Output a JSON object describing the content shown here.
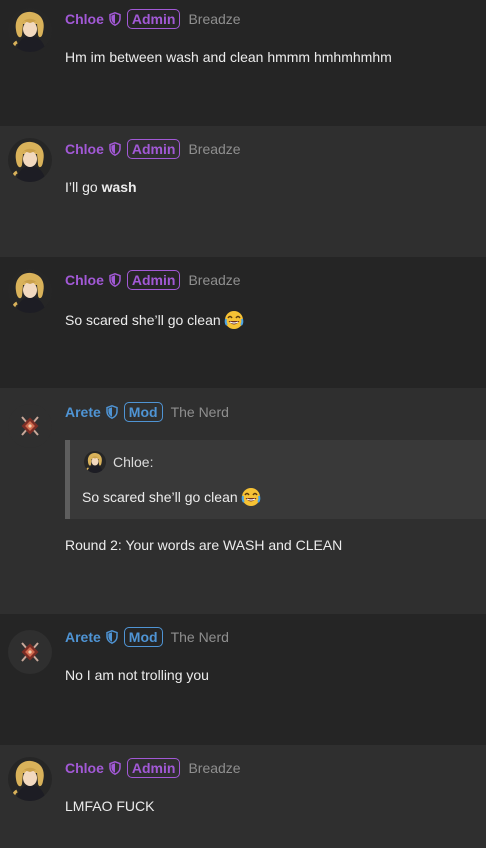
{
  "colors": {
    "admin": "#a259d6",
    "mod": "#4f94d4"
  },
  "messages": [
    {
      "user": "Chloe",
      "role": "Admin",
      "title": "Breadze",
      "text": "Hm im between wash and clean hmmm hmhmhmhm"
    },
    {
      "user": "Chloe",
      "role": "Admin",
      "title": "Breadze",
      "text_prefix": "I’ll go ",
      "text_bold": "wash"
    },
    {
      "user": "Chloe",
      "role": "Admin",
      "title": "Breadze",
      "text": "So scared she’ll go clean"
    },
    {
      "user": "Arete",
      "role": "Mod",
      "title": "The Nerd",
      "quote": {
        "author": "Chloe:",
        "text": "So scared she’ll go clean"
      },
      "text": "Round 2: Your words are WASH and CLEAN"
    },
    {
      "user": "Arete",
      "role": "Mod",
      "title": "The Nerd",
      "text": "No I am not trolling you"
    },
    {
      "user": "Chloe",
      "role": "Admin",
      "title": "Breadze",
      "text": "LMFAO FUCK"
    }
  ]
}
